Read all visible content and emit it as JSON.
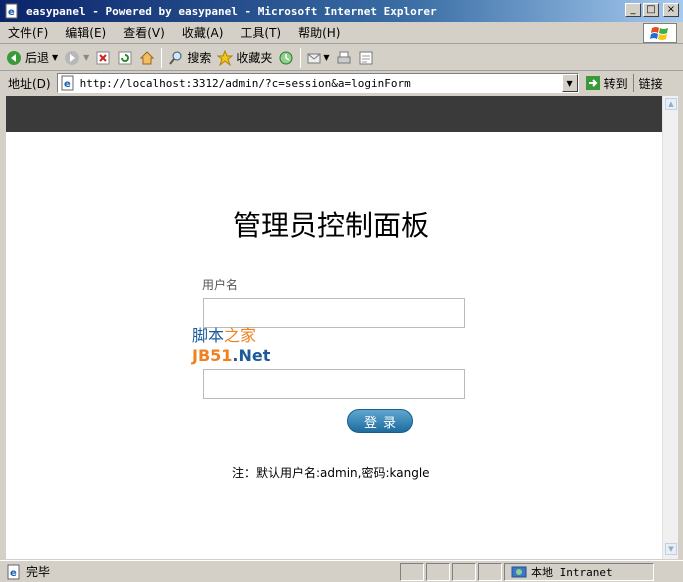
{
  "window": {
    "title": "easypanel - Powered by easypanel - Microsoft Internet Explorer",
    "minimize": "_",
    "maximize": "□",
    "close": "×"
  },
  "menu": [
    "文件(F)",
    "编辑(E)",
    "查看(V)",
    "收藏(A)",
    "工具(T)",
    "帮助(H)"
  ],
  "toolbar": {
    "back": "后退",
    "search": "搜索",
    "favorites": "收藏夹"
  },
  "address": {
    "label": "地址(D)",
    "url": "http://localhost:3312/admin/?c=session&a=loginForm",
    "go": "转到",
    "links": "链接"
  },
  "page": {
    "title": "管理员控制面板",
    "username_label": "用户名",
    "username_value": "",
    "password_value": "",
    "login_button": "登录",
    "note": "注：默认用户名:admin,密码:kangle",
    "watermark_line1a": "脚本",
    "watermark_line1b": "之家",
    "watermark_line2a": "JB51",
    "watermark_line2b": ".Net"
  },
  "status": {
    "text": "完毕",
    "zone": "本地 Intranet"
  },
  "icons": {
    "ie": "ie-page-icon",
    "back": "back-arrow-icon",
    "forward": "forward-arrow-icon",
    "stop": "stop-icon",
    "refresh": "refresh-icon",
    "home": "home-icon",
    "search": "search-icon",
    "favorites": "star-icon",
    "history": "history-icon",
    "mail": "mail-icon",
    "print": "print-icon",
    "edit": "edit-icon",
    "go": "go-arrow-icon",
    "zone": "globe-icon"
  },
  "colors": {
    "banner": "#3a3a3a",
    "login_button": "#2a7fb0",
    "watermark_blue": "#1c5a9c",
    "watermark_orange": "#f08020"
  }
}
